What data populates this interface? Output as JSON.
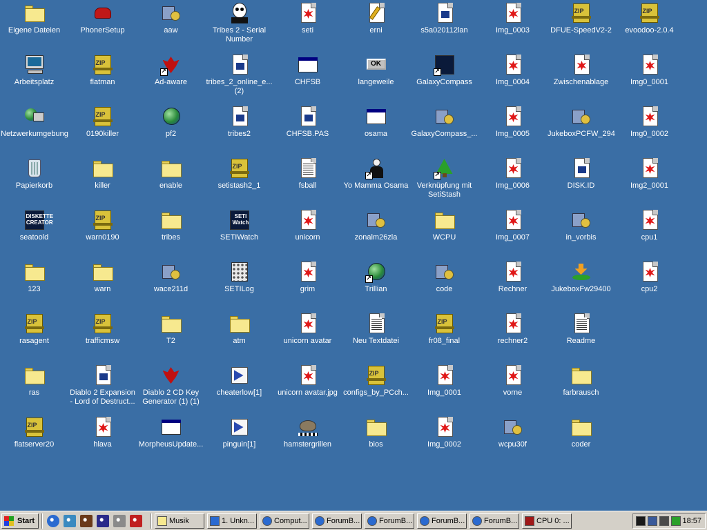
{
  "desktop": {
    "columns": [
      [
        {
          "label": "Eigene Dateien",
          "icon": "folder-documents-icon",
          "glyph": "folder"
        },
        {
          "label": "Arbeitsplatz",
          "icon": "my-computer-icon",
          "glyph": "pc"
        },
        {
          "label": "Netzwerkumgebung",
          "icon": "network-icon",
          "glyph": "net"
        },
        {
          "label": "Papierkorb",
          "icon": "recycle-bin-icon",
          "glyph": "bin"
        },
        {
          "label": "seatoold",
          "icon": "diskette-creator-icon",
          "glyph": "dark",
          "text": "DISKETTE CREATOR"
        },
        {
          "label": "123",
          "icon": "folder-icon",
          "glyph": "folder"
        },
        {
          "label": "rasagent",
          "icon": "zip-icon",
          "glyph": "zip"
        },
        {
          "label": "ras",
          "icon": "folder-icon",
          "glyph": "folder"
        },
        {
          "label": "flatserver20",
          "icon": "zip-icon",
          "glyph": "zip"
        }
      ],
      [
        {
          "label": "PhonerSetup",
          "icon": "phone-icon",
          "glyph": "phone"
        },
        {
          "label": "flatman",
          "icon": "zip-icon",
          "glyph": "zip"
        },
        {
          "label": "0190killer",
          "icon": "zip-icon",
          "glyph": "zip"
        },
        {
          "label": "killer",
          "icon": "folder-icon",
          "glyph": "folder"
        },
        {
          "label": "warn0190",
          "icon": "zip-icon",
          "glyph": "zip"
        },
        {
          "label": "warn",
          "icon": "folder-icon",
          "glyph": "folder"
        },
        {
          "label": "trafficmsw",
          "icon": "zip-icon",
          "glyph": "zip"
        },
        {
          "label": "Diablo 2 Expansion - Lord of Destruct...",
          "icon": "document-icon",
          "glyph": "doc"
        },
        {
          "label": "hlava",
          "icon": "image-file-icon",
          "glyph": "img"
        }
      ],
      [
        {
          "label": "aaw",
          "icon": "installer-icon",
          "glyph": "gear"
        },
        {
          "label": "Ad-aware",
          "icon": "ad-aware-icon",
          "glyph": "red",
          "shortcut": true
        },
        {
          "label": "pf2",
          "icon": "pf2-icon",
          "glyph": "globe"
        },
        {
          "label": "enable",
          "icon": "folder-icon",
          "glyph": "folder"
        },
        {
          "label": "tribes",
          "icon": "folder-icon",
          "glyph": "folder"
        },
        {
          "label": "wace211d",
          "icon": "installer-icon",
          "glyph": "gear"
        },
        {
          "label": "T2",
          "icon": "folder-icon",
          "glyph": "folder"
        },
        {
          "label": "Diablo 2 CD Key Generator (1) (1)",
          "icon": "diablo-icon",
          "glyph": "red"
        },
        {
          "label": "MorpheusUpdate...",
          "icon": "window-app-icon",
          "glyph": "win"
        }
      ],
      [
        {
          "label": "Tribes 2 - Serial Number",
          "icon": "jack-skellington-icon",
          "glyph": "skull"
        },
        {
          "label": "tribes_2_online_e... (2)",
          "icon": "document-icon",
          "glyph": "doc"
        },
        {
          "label": "tribes2",
          "icon": "document-icon",
          "glyph": "doc"
        },
        {
          "label": "setistash2_1",
          "icon": "zip-icon",
          "glyph": "zip"
        },
        {
          "label": "SETIWatch",
          "icon": "setiwatch-icon",
          "glyph": "dark",
          "text": "SETI Watch"
        },
        {
          "label": "SETILog",
          "icon": "calculator-icon",
          "glyph": "calc"
        },
        {
          "label": "atm",
          "icon": "folder-icon",
          "glyph": "folder"
        },
        {
          "label": "cheaterlow[1]",
          "icon": "media-file-icon",
          "glyph": "media"
        },
        {
          "label": "pinguin[1]",
          "icon": "media-file-icon",
          "glyph": "media"
        }
      ],
      [
        {
          "label": "seti",
          "icon": "image-file-icon",
          "glyph": "img"
        },
        {
          "label": "CHFSB",
          "icon": "window-app-icon",
          "glyph": "win"
        },
        {
          "label": "CHFSB.PAS",
          "icon": "document-icon",
          "glyph": "doc"
        },
        {
          "label": "fsball",
          "icon": "text-file-icon",
          "glyph": "txt"
        },
        {
          "label": "unicorn",
          "icon": "image-file-icon",
          "glyph": "img"
        },
        {
          "label": "grim",
          "icon": "image-file-icon",
          "glyph": "img"
        },
        {
          "label": "unicorn avatar",
          "icon": "image-file-icon",
          "glyph": "img"
        },
        {
          "label": "unicorn avatar.jpg",
          "icon": "image-file-icon",
          "glyph": "img"
        },
        {
          "label": "hamstergrillen",
          "icon": "movie-icon",
          "glyph": "hamster"
        }
      ],
      [
        {
          "label": "erni",
          "icon": "text-edit-icon",
          "glyph": "pen"
        },
        {
          "label": "langeweile",
          "icon": "ok-button-icon",
          "glyph": "ok",
          "text": "OK"
        },
        {
          "label": "osama",
          "icon": "window-app-icon",
          "glyph": "win"
        },
        {
          "label": "Yo Mamma Osama",
          "icon": "person-icon",
          "glyph": "person",
          "shortcut": true
        },
        {
          "label": "zonalm26zla",
          "icon": "installer-icon",
          "glyph": "gear"
        },
        {
          "label": "Trillian",
          "icon": "trillian-icon",
          "glyph": "globe",
          "shortcut": true
        },
        {
          "label": "Neu Textdatei",
          "icon": "text-file-icon",
          "glyph": "txt"
        },
        {
          "label": "configs_by_PCch...",
          "icon": "zip-icon",
          "glyph": "zip"
        },
        {
          "label": "bios",
          "icon": "folder-icon",
          "glyph": "folder"
        }
      ],
      [
        {
          "label": "s5a020112lan",
          "icon": "document-icon",
          "glyph": "doc"
        },
        {
          "label": "GalaxyCompass",
          "icon": "galaxy-compass-icon",
          "glyph": "dark",
          "text": "",
          "shortcut": true
        },
        {
          "label": "GalaxyCompass_...",
          "icon": "installer-icon",
          "glyph": "gear"
        },
        {
          "label": "Verknüpfung mit SetiStash",
          "icon": "setistash-icon",
          "glyph": "tree",
          "shortcut": true
        },
        {
          "label": "WCPU",
          "icon": "folder-icon",
          "glyph": "folder"
        },
        {
          "label": "code",
          "icon": "installer-icon",
          "glyph": "gear"
        },
        {
          "label": "fr08_final",
          "icon": "zip-icon",
          "glyph": "zip"
        },
        {
          "label": "Img_0001",
          "icon": "image-file-icon",
          "glyph": "img"
        },
        {
          "label": "Img_0002",
          "icon": "image-file-icon",
          "glyph": "img"
        }
      ],
      [
        {
          "label": "Img_0003",
          "icon": "image-file-icon",
          "glyph": "img"
        },
        {
          "label": "Img_0004",
          "icon": "image-file-icon",
          "glyph": "img"
        },
        {
          "label": "Img_0005",
          "icon": "image-file-icon",
          "glyph": "img"
        },
        {
          "label": "Img_0006",
          "icon": "image-file-icon",
          "glyph": "img"
        },
        {
          "label": "Img_0007",
          "icon": "image-file-icon",
          "glyph": "img"
        },
        {
          "label": "Rechner",
          "icon": "image-file-icon",
          "glyph": "img"
        },
        {
          "label": "rechner2",
          "icon": "image-file-icon",
          "glyph": "img"
        },
        {
          "label": "vorne",
          "icon": "image-file-icon",
          "glyph": "img"
        },
        {
          "label": "wcpu30f",
          "icon": "zip-installer-icon",
          "glyph": "gear"
        }
      ],
      [
        {
          "label": "DFUE-SpeedV2-2",
          "icon": "zip-icon",
          "glyph": "zip"
        },
        {
          "label": "Zwischenablage",
          "icon": "image-file-icon",
          "glyph": "img"
        },
        {
          "label": "JukeboxPCFW_294",
          "icon": "installer-icon",
          "glyph": "gear"
        },
        {
          "label": "DISK.ID",
          "icon": "document-icon",
          "glyph": "doc"
        },
        {
          "label": "in_vorbis",
          "icon": "installer-icon",
          "glyph": "gear"
        },
        {
          "label": "JukeboxFw29400",
          "icon": "download-icon",
          "glyph": "arrow"
        },
        {
          "label": "Readme",
          "icon": "text-file-icon",
          "glyph": "txt"
        },
        {
          "label": "farbrausch",
          "icon": "folder-icon",
          "glyph": "folder"
        },
        {
          "label": "coder",
          "icon": "folder-icon",
          "glyph": "folder"
        }
      ],
      [
        {
          "label": "evoodoo-2.0.4",
          "icon": "zip-icon",
          "glyph": "zip"
        },
        {
          "label": "Img0_0001",
          "icon": "image-file-icon",
          "glyph": "img"
        },
        {
          "label": "Img0_0002",
          "icon": "image-file-icon",
          "glyph": "img"
        },
        {
          "label": "Img2_0001",
          "icon": "image-file-icon",
          "glyph": "img"
        },
        {
          "label": "cpu1",
          "icon": "image-file-icon",
          "glyph": "img"
        },
        {
          "label": "cpu2",
          "icon": "image-file-icon",
          "glyph": "img"
        }
      ]
    ]
  },
  "taskbar": {
    "start_label": "Start",
    "quick_launch": [
      "ie-icon",
      "desktop-icon",
      "app-icon",
      "media-icon",
      "gear-icon",
      "messenger-icon"
    ],
    "buttons": [
      {
        "label": "Musik",
        "icon": "folder-icon"
      },
      {
        "label": "1. Unkn...",
        "icon": "media-icon"
      },
      {
        "label": "Comput...",
        "icon": "ie-icon"
      },
      {
        "label": "ForumB...",
        "icon": "ie-icon"
      },
      {
        "label": "ForumB...",
        "icon": "ie-icon"
      },
      {
        "label": "ForumB...",
        "icon": "ie-icon"
      },
      {
        "label": "ForumB...",
        "icon": "ie-icon"
      },
      {
        "label": "CPU 0: ...",
        "icon": "cpu-icon"
      }
    ],
    "tray_icons": [
      "cpu-meter-icon",
      "network-tray-icon",
      "volume-icon",
      "setistash-tray-icon"
    ],
    "clock": "18:57"
  }
}
